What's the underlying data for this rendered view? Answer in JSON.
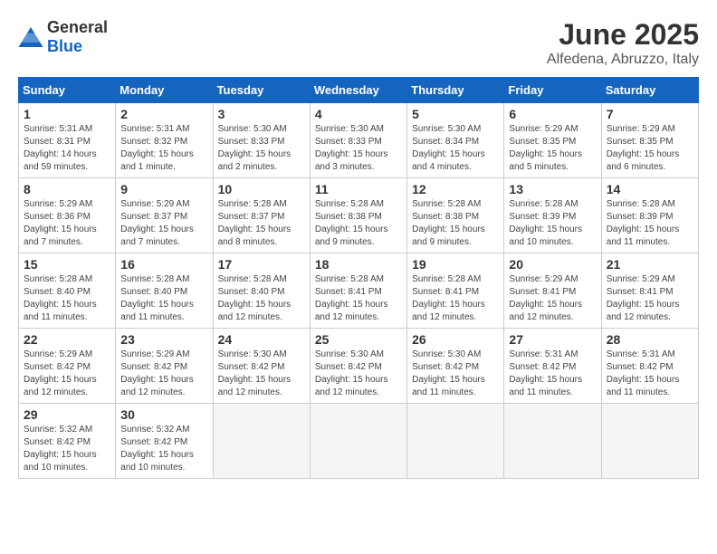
{
  "logo": {
    "general": "General",
    "blue": "Blue"
  },
  "title": "June 2025",
  "location": "Alfedena, Abruzzo, Italy",
  "weekdays": [
    "Sunday",
    "Monday",
    "Tuesday",
    "Wednesday",
    "Thursday",
    "Friday",
    "Saturday"
  ],
  "weeks": [
    [
      {
        "day": "1",
        "info": "Sunrise: 5:31 AM\nSunset: 8:31 PM\nDaylight: 14 hours\nand 59 minutes."
      },
      {
        "day": "2",
        "info": "Sunrise: 5:31 AM\nSunset: 8:32 PM\nDaylight: 15 hours\nand 1 minute."
      },
      {
        "day": "3",
        "info": "Sunrise: 5:30 AM\nSunset: 8:33 PM\nDaylight: 15 hours\nand 2 minutes."
      },
      {
        "day": "4",
        "info": "Sunrise: 5:30 AM\nSunset: 8:33 PM\nDaylight: 15 hours\nand 3 minutes."
      },
      {
        "day": "5",
        "info": "Sunrise: 5:30 AM\nSunset: 8:34 PM\nDaylight: 15 hours\nand 4 minutes."
      },
      {
        "day": "6",
        "info": "Sunrise: 5:29 AM\nSunset: 8:35 PM\nDaylight: 15 hours\nand 5 minutes."
      },
      {
        "day": "7",
        "info": "Sunrise: 5:29 AM\nSunset: 8:35 PM\nDaylight: 15 hours\nand 6 minutes."
      }
    ],
    [
      {
        "day": "8",
        "info": "Sunrise: 5:29 AM\nSunset: 8:36 PM\nDaylight: 15 hours\nand 7 minutes."
      },
      {
        "day": "9",
        "info": "Sunrise: 5:29 AM\nSunset: 8:37 PM\nDaylight: 15 hours\nand 7 minutes."
      },
      {
        "day": "10",
        "info": "Sunrise: 5:28 AM\nSunset: 8:37 PM\nDaylight: 15 hours\nand 8 minutes."
      },
      {
        "day": "11",
        "info": "Sunrise: 5:28 AM\nSunset: 8:38 PM\nDaylight: 15 hours\nand 9 minutes."
      },
      {
        "day": "12",
        "info": "Sunrise: 5:28 AM\nSunset: 8:38 PM\nDaylight: 15 hours\nand 9 minutes."
      },
      {
        "day": "13",
        "info": "Sunrise: 5:28 AM\nSunset: 8:39 PM\nDaylight: 15 hours\nand 10 minutes."
      },
      {
        "day": "14",
        "info": "Sunrise: 5:28 AM\nSunset: 8:39 PM\nDaylight: 15 hours\nand 11 minutes."
      }
    ],
    [
      {
        "day": "15",
        "info": "Sunrise: 5:28 AM\nSunset: 8:40 PM\nDaylight: 15 hours\nand 11 minutes."
      },
      {
        "day": "16",
        "info": "Sunrise: 5:28 AM\nSunset: 8:40 PM\nDaylight: 15 hours\nand 11 minutes."
      },
      {
        "day": "17",
        "info": "Sunrise: 5:28 AM\nSunset: 8:40 PM\nDaylight: 15 hours\nand 12 minutes."
      },
      {
        "day": "18",
        "info": "Sunrise: 5:28 AM\nSunset: 8:41 PM\nDaylight: 15 hours\nand 12 minutes."
      },
      {
        "day": "19",
        "info": "Sunrise: 5:28 AM\nSunset: 8:41 PM\nDaylight: 15 hours\nand 12 minutes."
      },
      {
        "day": "20",
        "info": "Sunrise: 5:29 AM\nSunset: 8:41 PM\nDaylight: 15 hours\nand 12 minutes."
      },
      {
        "day": "21",
        "info": "Sunrise: 5:29 AM\nSunset: 8:41 PM\nDaylight: 15 hours\nand 12 minutes."
      }
    ],
    [
      {
        "day": "22",
        "info": "Sunrise: 5:29 AM\nSunset: 8:42 PM\nDaylight: 15 hours\nand 12 minutes."
      },
      {
        "day": "23",
        "info": "Sunrise: 5:29 AM\nSunset: 8:42 PM\nDaylight: 15 hours\nand 12 minutes."
      },
      {
        "day": "24",
        "info": "Sunrise: 5:30 AM\nSunset: 8:42 PM\nDaylight: 15 hours\nand 12 minutes."
      },
      {
        "day": "25",
        "info": "Sunrise: 5:30 AM\nSunset: 8:42 PM\nDaylight: 15 hours\nand 12 minutes."
      },
      {
        "day": "26",
        "info": "Sunrise: 5:30 AM\nSunset: 8:42 PM\nDaylight: 15 hours\nand 11 minutes."
      },
      {
        "day": "27",
        "info": "Sunrise: 5:31 AM\nSunset: 8:42 PM\nDaylight: 15 hours\nand 11 minutes."
      },
      {
        "day": "28",
        "info": "Sunrise: 5:31 AM\nSunset: 8:42 PM\nDaylight: 15 hours\nand 11 minutes."
      }
    ],
    [
      {
        "day": "29",
        "info": "Sunrise: 5:32 AM\nSunset: 8:42 PM\nDaylight: 15 hours\nand 10 minutes."
      },
      {
        "day": "30",
        "info": "Sunrise: 5:32 AM\nSunset: 8:42 PM\nDaylight: 15 hours\nand 10 minutes."
      },
      {
        "day": "",
        "info": ""
      },
      {
        "day": "",
        "info": ""
      },
      {
        "day": "",
        "info": ""
      },
      {
        "day": "",
        "info": ""
      },
      {
        "day": "",
        "info": ""
      }
    ]
  ]
}
